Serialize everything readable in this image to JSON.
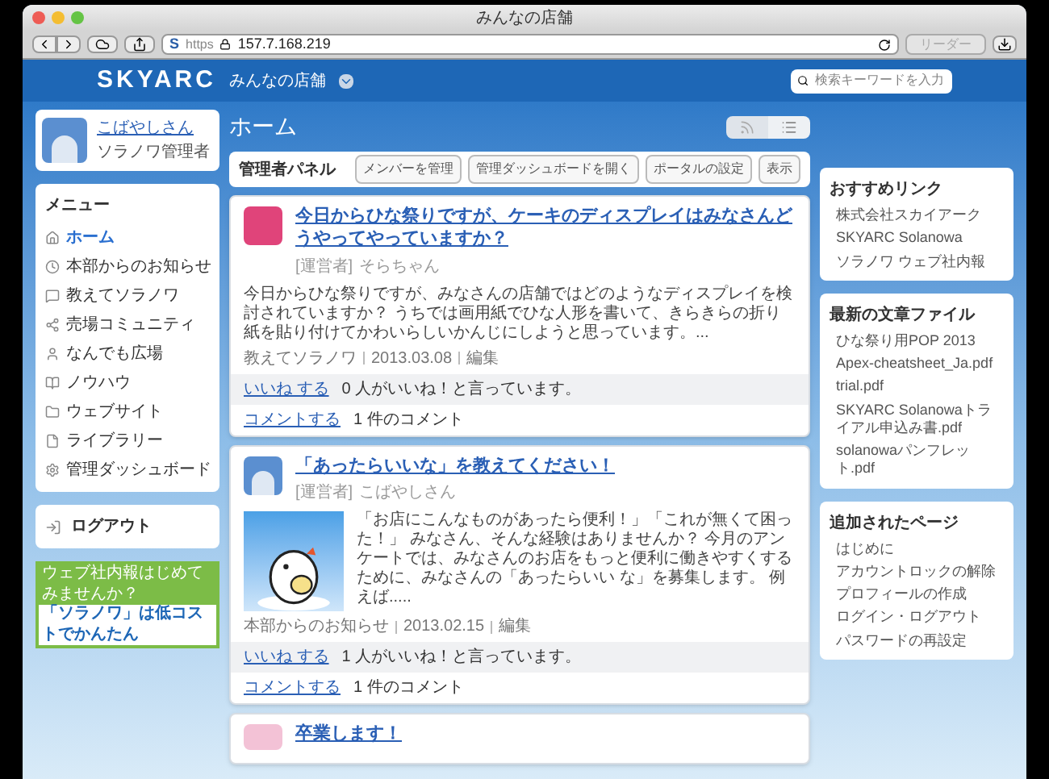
{
  "window": {
    "title": "みんなの店舗"
  },
  "browser": {
    "site_icon": "S",
    "scheme": "https",
    "url": "157.7.168.219",
    "reader_button": "リーダー"
  },
  "header": {
    "logo": "SKYARC",
    "site_name": "みんなの店舗",
    "search": {
      "placeholder": "検索キーワードを入力"
    }
  },
  "user": {
    "name": "こばやしさん",
    "role": "ソラノワ管理者"
  },
  "menu": {
    "title": "メニュー",
    "items": [
      {
        "label": "ホーム",
        "selected": true
      },
      {
        "label": "本部からのお知らせ",
        "selected": false
      },
      {
        "label": "教えてソラノワ",
        "selected": false
      },
      {
        "label": "売場コミュニティ",
        "selected": false
      },
      {
        "label": "なんでも広場",
        "selected": false
      },
      {
        "label": "ノウハウ",
        "selected": false
      },
      {
        "label": "ウェブサイト",
        "selected": false
      },
      {
        "label": "ライブラリー",
        "selected": false
      },
      {
        "label": "管理ダッシュボード",
        "selected": false
      }
    ]
  },
  "logout": "ログアウト",
  "banner": {
    "headline": "ウェブ社内報はじめてみませんか？",
    "tagline": "「ソラノワ」は低コストでかんたん"
  },
  "page_title": "ホーム",
  "admin_panel": {
    "title": "管理者パネル",
    "buttons": [
      "メンバーを管理",
      "管理ダッシュボードを開く",
      "ポータルの設定",
      "表示"
    ]
  },
  "posts": [
    {
      "kind": "text",
      "title": "今日からひな祭りですが、ケーキのディスプレイはみなさんどうやってやっていますか？",
      "role": "[運営者]",
      "author": "そらちゃん",
      "body": "今日からひな祭りですが、みなさんの店舗ではどのようなディスプレイを検討されていますか？ うちでは画用紙でひな人形を書いて、きらきらの折り紙を貼り付けてかわいらしいかんじにしようと思っています。...",
      "category": "教えてソラノワ",
      "date": "2013.03.08",
      "edit": "編集",
      "like_link": "いいね する",
      "likes": "0 人がいいね！と言っています。",
      "comment_link": "コメントする",
      "comments": "1 件のコメント"
    },
    {
      "kind": "image",
      "title": "「あったらいいな」を教えてください！",
      "role": "[運営者]",
      "author": "こばやしさん",
      "body": "「お店にこんなものがあったら便利！」「これが無くて困った！」 みなさん、そんな経験はありませんか？ 今月のアンケートでは、みなさんのお店をもっと便利に働きやすくするために、みなさんの「あったらいい な」を募集します。 例えば.....",
      "category": "本部からのお知らせ",
      "date": "2013.02.15",
      "edit": "編集",
      "like_link": "いいね する",
      "likes": "1 人がいいね！と言っています。",
      "comment_link": "コメントする",
      "comments": "1 件のコメント"
    },
    {
      "kind": "title_only",
      "title": "卒業します！"
    }
  ],
  "widgets": [
    {
      "title": "おすすめリンク",
      "items": [
        "株式会社スカイアーク",
        "SKYARC Solanowa",
        "ソラノワ ウェブ社内報"
      ]
    },
    {
      "title": "最新の文章ファイル",
      "items": [
        "ひな祭り用POP 2013",
        "Apex-cheatsheet_Ja.pdf",
        "trial.pdf",
        "SKYARC Solanowaトライアル申込み書.pdf",
        "solanowaパンフレット.pdf"
      ]
    },
    {
      "title": "追加されたページ",
      "items": [
        "はじめに",
        "アカウントロックの解除",
        "プロフィールの作成",
        "ログイン・ログアウト",
        "パスワードの再設定"
      ]
    }
  ]
}
